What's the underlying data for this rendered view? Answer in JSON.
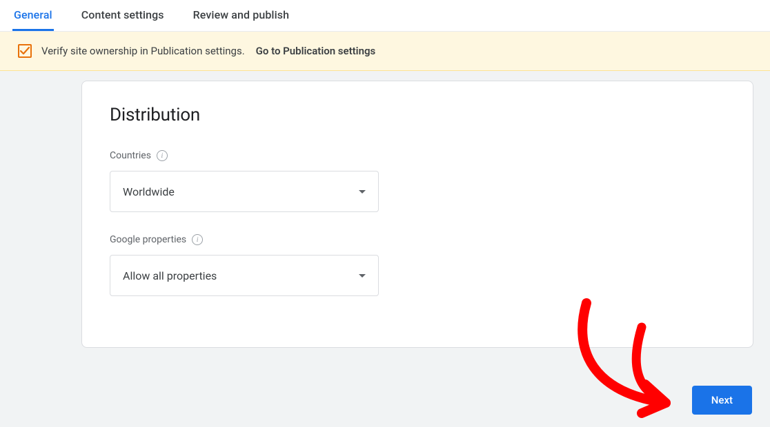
{
  "tabs": [
    {
      "label": "General",
      "active": true
    },
    {
      "label": "Content settings",
      "active": false
    },
    {
      "label": "Review and publish",
      "active": false
    }
  ],
  "banner": {
    "text": "Verify site ownership in Publication settings.",
    "link_label": "Go to Publication settings"
  },
  "card": {
    "title": "Distribution",
    "countries": {
      "label": "Countries",
      "value": "Worldwide"
    },
    "properties": {
      "label": "Google properties",
      "value": "Allow all properties"
    }
  },
  "next_label": "Next"
}
